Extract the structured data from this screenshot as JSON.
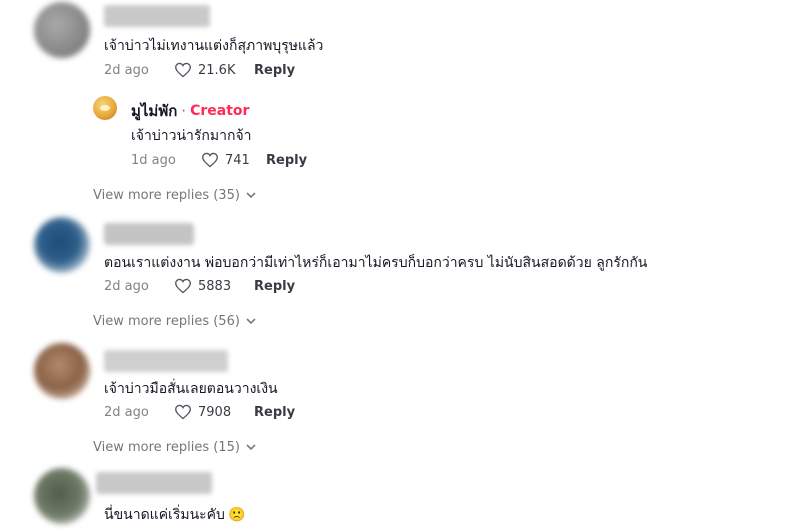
{
  "comments": [
    {
      "text": "เจ้าบ่าวไม่เทงานแต่งก็สุภาพบุรุษแล้ว",
      "time": "2d ago",
      "likes": "21.6K",
      "reply_label": "Reply",
      "view_more": "View more replies (35)",
      "reply": {
        "author": "มูไม่พัก",
        "separator": "·",
        "badge": "Creator",
        "text": "เจ้าบ่าวน่ารักมากจ้า",
        "time": "1d ago",
        "likes": "741",
        "reply_label": "Reply"
      }
    },
    {
      "text": "ตอนเราแต่งงาน พ่อบอกว่ามีเท่าไหร่ก็เอามาไม่ครบก็บอกว่าครบ ไม่นับสินสอดด้วย ลูกรักกัน",
      "time": "2d ago",
      "likes": "5883",
      "reply_label": "Reply",
      "view_more": "View more replies (56)"
    },
    {
      "text": "เจ้าบ่าวมือสั่นเลยตอนวางเงิน",
      "time": "2d ago",
      "likes": "7908",
      "reply_label": "Reply",
      "view_more": "View more replies (15)"
    },
    {
      "text": "นี่ขนาดแค่เริ่มนะคับ",
      "emoji": "🙁"
    }
  ],
  "colors": {
    "accent": "#fe2c55",
    "text": "#161823"
  }
}
